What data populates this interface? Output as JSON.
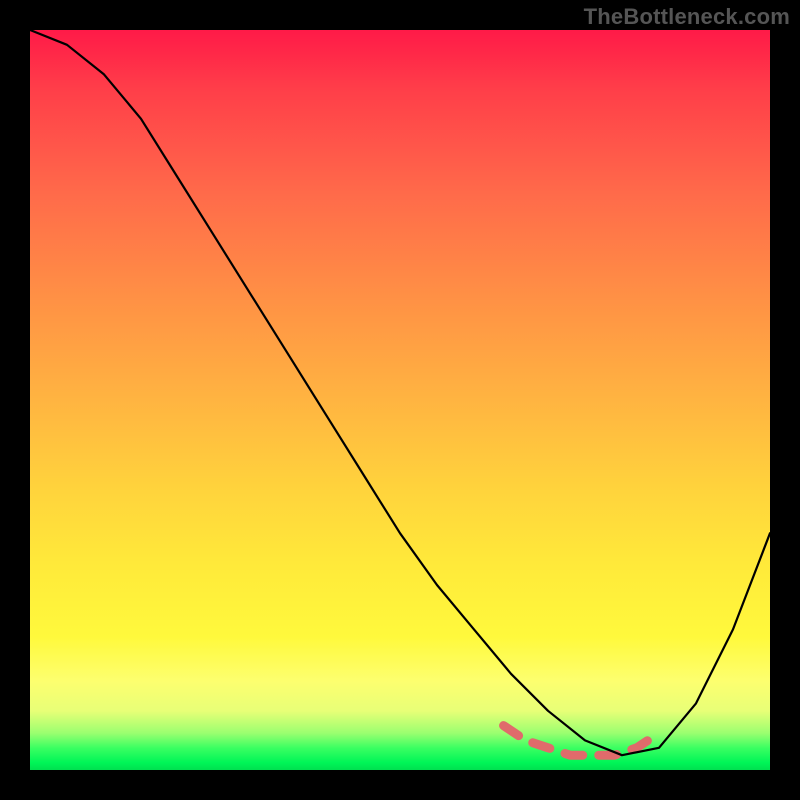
{
  "watermark": "TheBottleneck.com",
  "colors": {
    "frame_bg": "#000000",
    "gradient_top": "#ff1a48",
    "gradient_bottom": "#00e050",
    "curve": "#000000",
    "highlight": "#e06b6b",
    "watermark_text": "#555555"
  },
  "chart_data": {
    "type": "line",
    "title": "",
    "xlabel": "",
    "ylabel": "",
    "xlim": [
      0,
      100
    ],
    "ylim": [
      0,
      100
    ],
    "grid": false,
    "legend": false,
    "series": [
      {
        "name": "bottleneck-curve",
        "x": [
          0,
          5,
          10,
          15,
          20,
          25,
          30,
          35,
          40,
          45,
          50,
          55,
          60,
          65,
          70,
          75,
          80,
          85,
          90,
          95,
          100
        ],
        "values": [
          100,
          98,
          94,
          88,
          80,
          72,
          64,
          56,
          48,
          40,
          32,
          25,
          19,
          13,
          8,
          4,
          2,
          3,
          9,
          19,
          32
        ]
      }
    ],
    "annotations": [
      {
        "name": "optimal-range",
        "style": "dashed",
        "color": "#e06b6b",
        "x": [
          64,
          67,
          70,
          73,
          76,
          79,
          82,
          85
        ],
        "values": [
          6,
          4,
          3,
          2,
          2,
          2,
          3,
          5
        ]
      }
    ]
  }
}
